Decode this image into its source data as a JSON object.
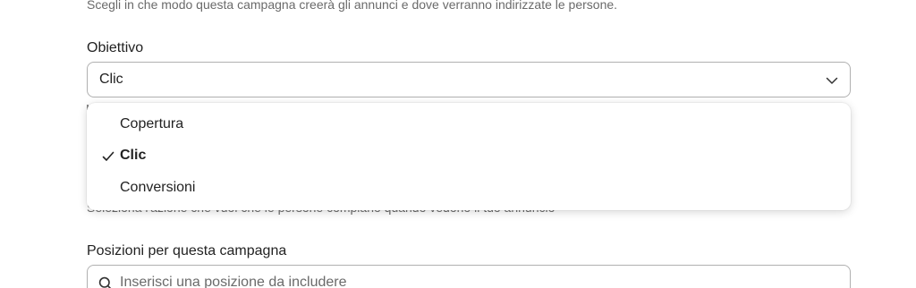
{
  "intro_text": "Scegli in che modo questa campagna creerà gli annunci e dove verranno indirizzate le persone.",
  "objective": {
    "label": "Obiettivo",
    "selected_value": "Clic",
    "options": [
      {
        "label": "Copertura",
        "selected": false
      },
      {
        "label": "Clic",
        "selected": true
      },
      {
        "label": "Conversioni",
        "selected": false
      }
    ]
  },
  "action_helper": "Seleziona l'azione che vuoi che le persone compiano quando vedono il tuo annuncio",
  "locations": {
    "label": "Posizioni per questa campagna",
    "placeholder": "Inserisci una posizione da includere"
  },
  "icons": {
    "dropdown": "chevron-down-icon",
    "selected": "checkmark-icon",
    "search": "search-icon"
  }
}
